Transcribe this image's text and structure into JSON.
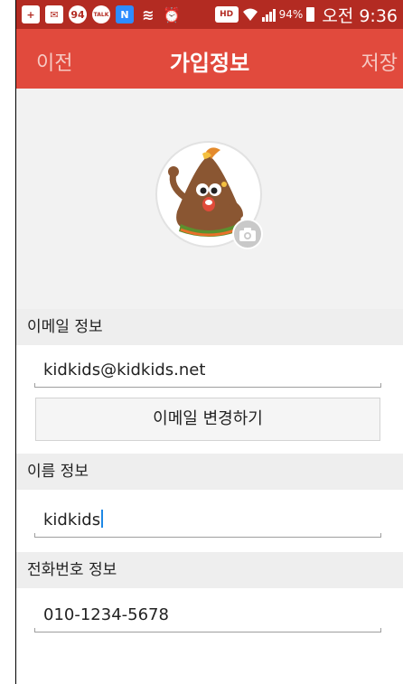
{
  "status_bar": {
    "icons": [
      "add-icon",
      "mail-icon",
      "badge-94-icon",
      "talk-icon",
      "n-icon",
      "vibrate-icon",
      "alarm-icon",
      "hd-voice-icon",
      "wifi-icon",
      "signal-icon"
    ],
    "badge_number": "94",
    "talk_text": "TALK",
    "n_text": "N",
    "hd_text": "HD",
    "battery": "94%",
    "time": "오전 9:36",
    "colors": {
      "background": "#b32b22"
    }
  },
  "header": {
    "back_label": "이전",
    "title": "가입정보",
    "save_label": "저장",
    "colors": {
      "background": "#e14a3d",
      "action_text": "#f6c9c3"
    }
  },
  "avatar": {
    "icon": "character-avatar-icon",
    "camera_icon": "camera-icon"
  },
  "email": {
    "section_label": "이메일 정보",
    "value": "kidkids@kidkids.net",
    "change_button_label": "이메일 변경하기"
  },
  "name": {
    "section_label": "이름 정보",
    "value": "kidkids"
  },
  "phone": {
    "section_label": "전화번호 정보",
    "value": "010-1234-5678"
  }
}
